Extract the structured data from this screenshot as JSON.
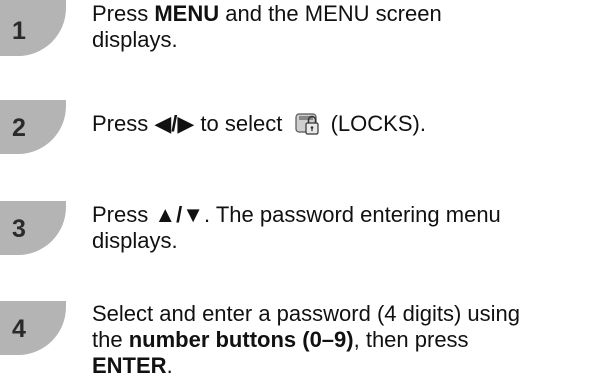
{
  "steps": [
    {
      "number": "1",
      "t1": "Press ",
      "b1": "MENU",
      "t2": " and the MENU screen",
      "t3": "displays."
    },
    {
      "number": "2",
      "t1": "Press ",
      "arrows": "◀/▶",
      "t2": " to select ",
      "t3": " (LOCKS).",
      "icon": "lock-icon"
    },
    {
      "number": "3",
      "t1": "Press ",
      "arrows": "▲/▼",
      "t2": ". The password entering menu",
      "t3": "displays."
    },
    {
      "number": "4",
      "t1": "Select and enter a password (4 digits) using",
      "t2": "the ",
      "b1": "number buttons (0–9)",
      "t3": ", then press",
      "b2": "ENTER",
      "t4": "."
    }
  ]
}
